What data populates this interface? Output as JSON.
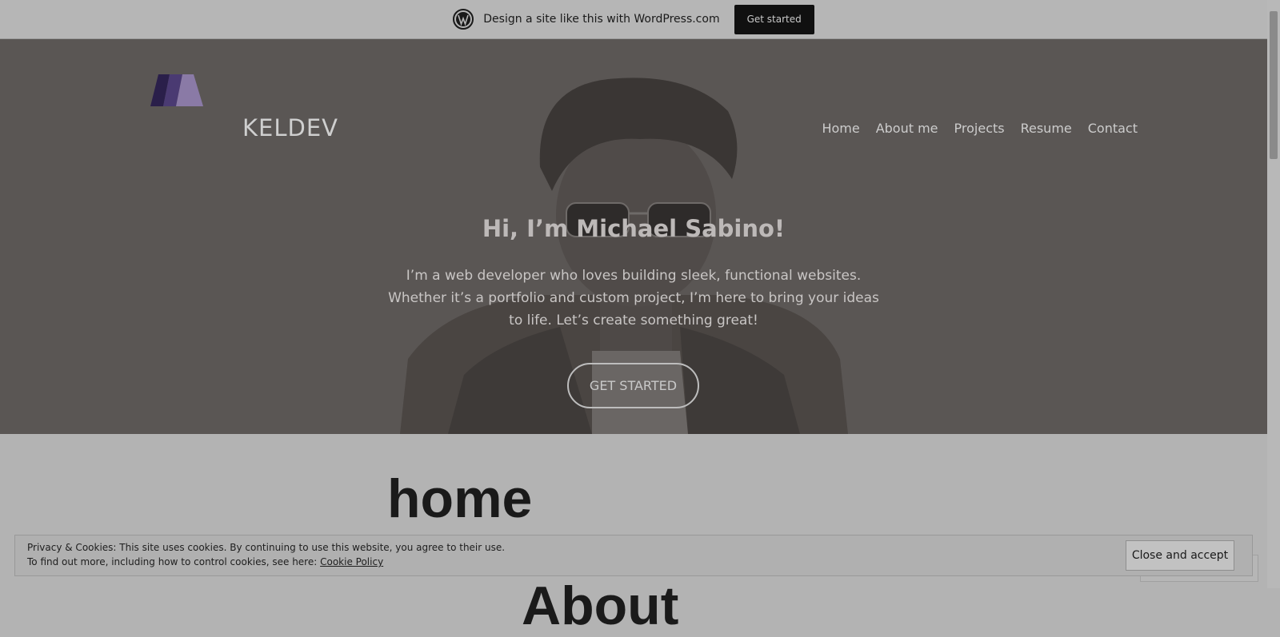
{
  "promo_bar": {
    "text": "Design a site like this with WordPress.com",
    "button_label": "Get started"
  },
  "header": {
    "site_title": "KELDEV",
    "nav": [
      "Home",
      "About me",
      "Projects",
      "Resume",
      "Contact"
    ]
  },
  "hero": {
    "title": "Hi, I’m Michael Sabino!",
    "text": "I’m a web developer who loves building sleek, functional websites. Whether it’s a portfolio and custom project, I’m here to bring your ideas to life. Let’s create something great!",
    "cta_label": "GET STARTED"
  },
  "content": {
    "page_heading": "home",
    "next_heading": "About"
  },
  "cookie_banner": {
    "line1": "Privacy & Cookies: This site uses cookies. By continuing to use this website, you agree to their use.",
    "line2_prefix": "To find out more, including how to control cookies, see here:",
    "policy_link": "Cookie Policy",
    "accept_label": "Close and accept"
  },
  "colors": {
    "overlay_gray": "#b3b3b3",
    "hero_bg": "#5a5654",
    "logo_dark": "#2a1f4a",
    "logo_light": "#8a7aa6"
  }
}
